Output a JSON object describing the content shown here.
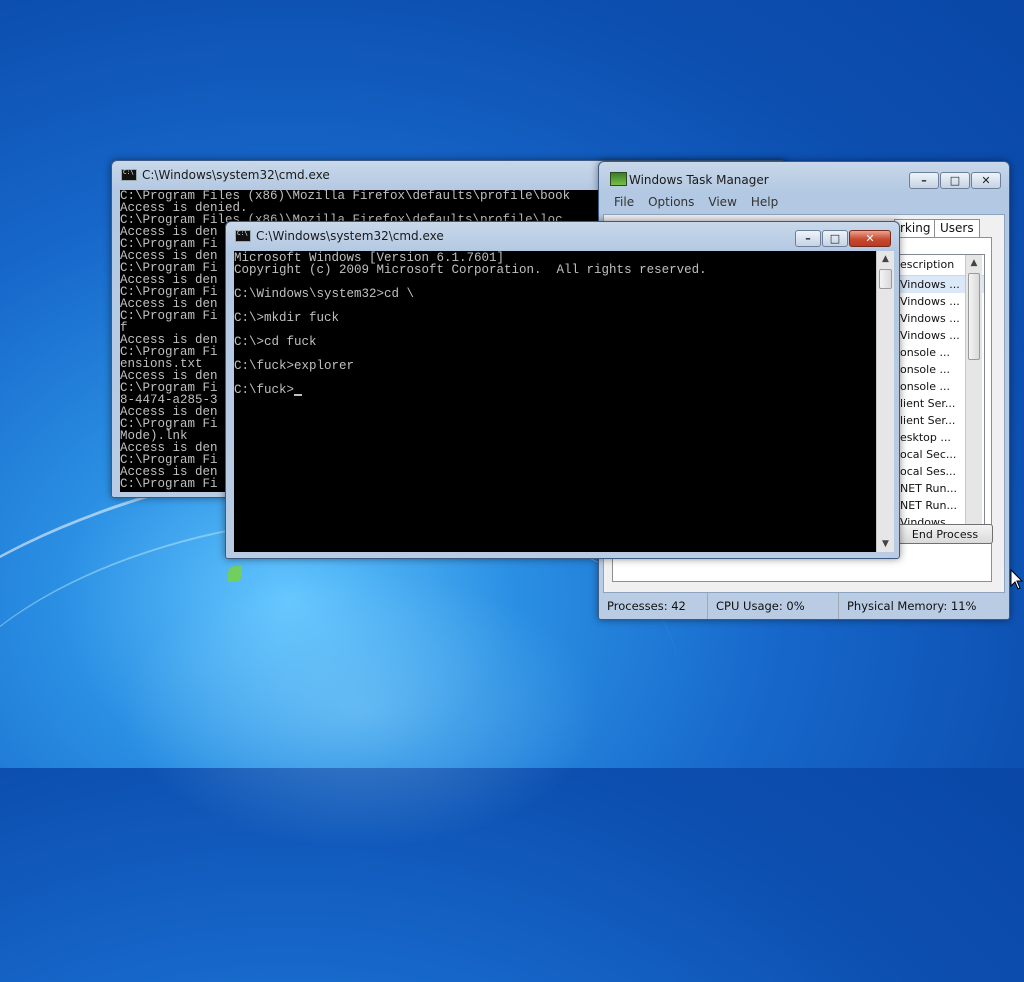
{
  "cmd_back": {
    "title": "C:\\Windows\\system32\\cmd.exe",
    "lines": [
      "C:\\Program Files (x86)\\Mozilla Firefox\\defaults\\profile\\book",
      "Access is denied.",
      "C:\\Program Files (x86)\\Mozilla Firefox\\defaults\\profile\\loc",
      "Access is den",
      "C:\\Program Fi",
      "Access is den",
      "C:\\Program Fi",
      "Access is den",
      "C:\\Program Fi",
      "Access is den",
      "C:\\Program Fi",
      "f",
      "Access is den",
      "C:\\Program Fi",
      "ensions.txt",
      "Access is den",
      "C:\\Program Fi",
      "8-4474-a285-3",
      "Access is den",
      "C:\\Program Fi",
      "Mode).lnk",
      "Access is den",
      "C:\\Program Fi",
      "Access is den",
      "C:\\Program Fi"
    ]
  },
  "cmd_front": {
    "title": "C:\\Windows\\system32\\cmd.exe",
    "lines": [
      "Microsoft Windows [Version 6.1.7601]",
      "Copyright (c) 2009 Microsoft Corporation.  All rights reserved.",
      "",
      "C:\\Windows\\system32>cd \\",
      "",
      "C:\\>mkdir fuck",
      "",
      "C:\\>cd fuck",
      "",
      "C:\\fuck>explorer",
      "",
      "C:\\fuck>"
    ]
  },
  "task_manager": {
    "title": "Windows Task Manager",
    "menu": [
      "File",
      "Options",
      "View",
      "Help"
    ],
    "tabs": [
      "rking",
      "Users"
    ],
    "column_header": "escription",
    "rows": [
      "Vindows ...",
      "Vindows ...",
      "Vindows ...",
      "Vindows ...",
      "onsole ...",
      "onsole ...",
      "onsole ...",
      "lient Ser...",
      "lient Ser...",
      "esktop ...",
      "ocal Sec...",
      "ocal Ses...",
      "NET Run...",
      "NET Run...",
      "Vindows..."
    ],
    "end_process": "End Process",
    "status": {
      "processes": "Processes: 42",
      "cpu": "CPU Usage: 0%",
      "memory": "Physical Memory: 11%"
    }
  },
  "window_controls": {
    "minimize": "–",
    "maximize": "□",
    "close": "✕"
  }
}
